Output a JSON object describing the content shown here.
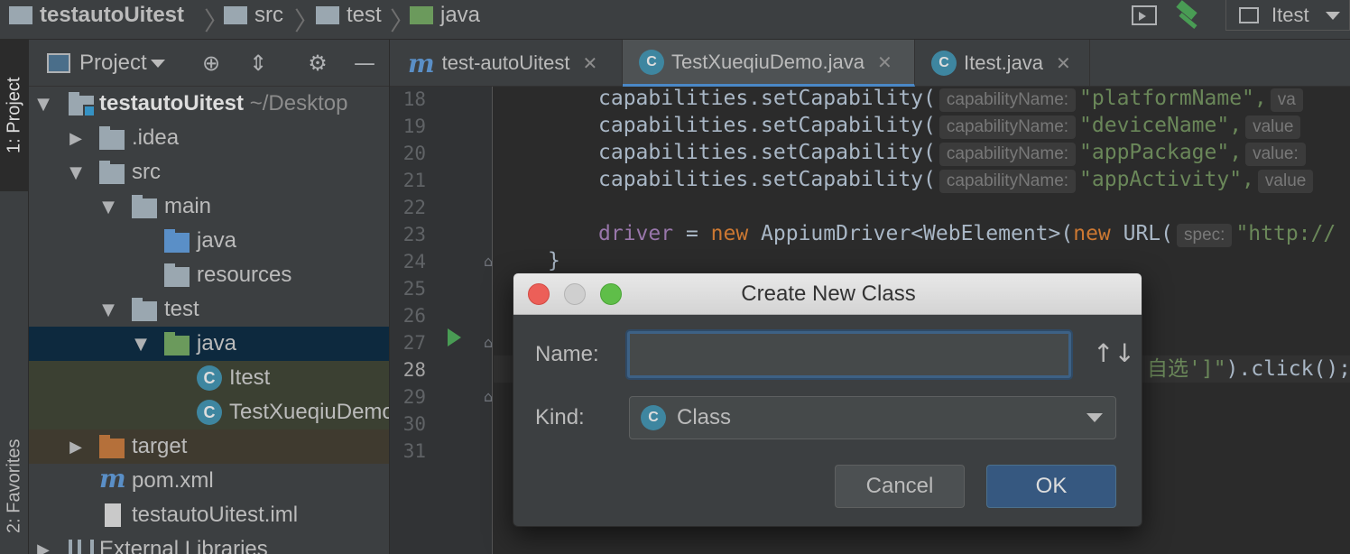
{
  "breadcrumb": {
    "items": [
      {
        "label": "testautoUitest",
        "icon": "module-folder-icon"
      },
      {
        "label": "src",
        "icon": "folder-icon"
      },
      {
        "label": "test",
        "icon": "folder-icon"
      },
      {
        "label": "java",
        "icon": "test-source-folder-icon"
      }
    ]
  },
  "toolbar": {
    "run_config_label": "Itest"
  },
  "tool_stripe": {
    "project_tab": "1: Project",
    "favorites_tab": "2: Favorites"
  },
  "project_panel": {
    "title": "Project",
    "tree": [
      {
        "label": "testautoUitest",
        "suffix": "~/Desktop"
      },
      {
        "label": ".idea"
      },
      {
        "label": "src"
      },
      {
        "label": "main"
      },
      {
        "label": "java"
      },
      {
        "label": "resources"
      },
      {
        "label": "test"
      },
      {
        "label": "java"
      },
      {
        "label": "Itest"
      },
      {
        "label": "TestXueqiuDemo"
      },
      {
        "label": "target"
      },
      {
        "label": "pom.xml"
      },
      {
        "label": "testautoUitest.iml"
      },
      {
        "label": "External Libraries"
      }
    ]
  },
  "editor_tabs": [
    {
      "label": "test-autoUitest",
      "icon": "maven-icon",
      "active": false
    },
    {
      "label": "TestXueqiuDemo.java",
      "icon": "java-class-icon",
      "active": true
    },
    {
      "label": "Itest.java",
      "icon": "java-class-icon",
      "active": false
    }
  ],
  "editor": {
    "line_numbers": [
      "18",
      "19",
      "20",
      "21",
      "22",
      "23",
      "24",
      "25",
      "26",
      "27",
      "28",
      "29",
      "30",
      "31"
    ],
    "lines": {
      "l18": {
        "prefix": "capabilities.setCapability(",
        "hint": "capabilityName:",
        "arg": "\"platformName\",",
        "tail_hint": "va"
      },
      "l19": {
        "prefix": "capabilities.setCapability(",
        "hint": "capabilityName:",
        "arg": "\"deviceName\",",
        "tail_hint": "value"
      },
      "l20": {
        "prefix": "capabilities.setCapability(",
        "hint": "capabilityName:",
        "arg": "\"appPackage\",",
        "tail_hint": "value:"
      },
      "l21": {
        "prefix": "capabilities.setCapability(",
        "hint": "capabilityName:",
        "arg": "\"appActivity\",",
        "tail_hint": "value"
      },
      "l23": {
        "field": "driver",
        "op": " = ",
        "kw1": "new",
        "mid": " AppiumDriver<WebElement>(",
        "kw2": "new",
        "mid2": " URL(",
        "hint": "spec:",
        "str": "\"http://"
      },
      "l24": {
        "text": "}"
      },
      "l28": {
        "str": "自选']\"",
        "tail": ").click();"
      }
    }
  },
  "dialog": {
    "title": "Create New Class",
    "name_label": "Name:",
    "name_value": "",
    "kind_label": "Kind:",
    "kind_value": "Class",
    "cancel_label": "Cancel",
    "ok_label": "OK"
  }
}
